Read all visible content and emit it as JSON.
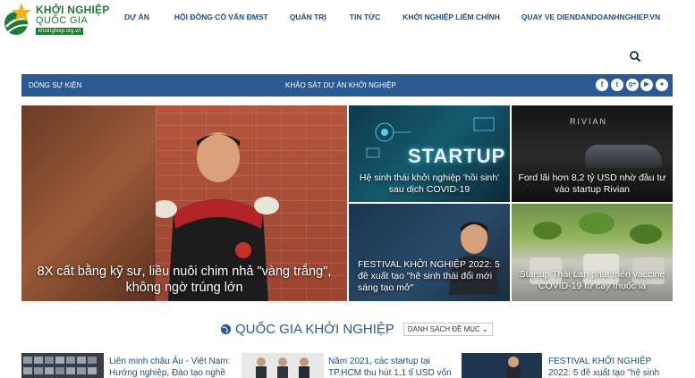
{
  "logo": {
    "line1": "KHỞI NGHIỆP",
    "line2": "QUỐC GIA",
    "line3": "khoinghiep.org.vn"
  },
  "nav": {
    "items": [
      {
        "label": "DỰ ÁN"
      },
      {
        "label": "HỘI ĐỒNG CỐ VẤN ĐMST"
      },
      {
        "label": "QUẢN TRỊ"
      },
      {
        "label": "TIN TỨC"
      },
      {
        "label": "KHỞI NGHIỆP LIÊM CHÍNH"
      },
      {
        "label": "QUAY VE DIENDANDOANHNGHIEP.VN"
      }
    ]
  },
  "bluebar": {
    "left_label": "DÒNG SỰ KIỆN",
    "center_label": "KHẢO SÁT DỰ ÁN KHỞI NGHIỆP",
    "social": [
      {
        "icon": "facebook-icon",
        "glyph": "f"
      },
      {
        "icon": "twitter-icon",
        "glyph": "t"
      },
      {
        "icon": "google-plus-icon",
        "glyph": "g+"
      },
      {
        "icon": "youtube-icon",
        "glyph": "▶"
      },
      {
        "icon": "user-icon",
        "glyph": "●"
      }
    ],
    "color": "#2b5a92"
  },
  "tiles": {
    "big": {
      "caption": "8X cất bằng kỹ sư, liều nuôi chim nhả \"vàng trắng\", không ngờ trúng lớn"
    },
    "t2": {
      "overlay": "STARTUP",
      "caption": "Hệ sinh thái khởi nghiệp 'hồi sinh' sau dịch COVID-19"
    },
    "t3": {
      "overlay": "RIVIAN",
      "caption": "Ford lãi hơn 8,2 tỷ USD nhờ đầu tư vào startup Rivian"
    },
    "t4": {
      "caption": "FESTIVAL KHỞI NGHIỆP 2022: 5 đề xuất tạo \"hệ sinh thái đổi mới sáng tạo mở\""
    },
    "t5": {
      "caption": "Startup Thái Lan phát triển vaccine COVID-19 từ cây thuốc lá"
    }
  },
  "section": {
    "title": "QUỐC GIA KHỞI NGHIỆP",
    "dropdown_label": "DANH SÁCH ĐỀ MỤC ⌄"
  },
  "bottom_list": [
    {
      "text": "Liên minh châu Âu - Việt Nam: Hướng nghiệp, Đào tạo nghề và"
    },
    {
      "text": "Năm 2021, các startup tại TP.HCM thu hút 1,1 tỉ USD vốn"
    },
    {
      "text": "FESTIVAL KHỞI NGHIỆP 2022: 5 đề xuất tạo \"hệ sinh thái đổi"
    }
  ]
}
